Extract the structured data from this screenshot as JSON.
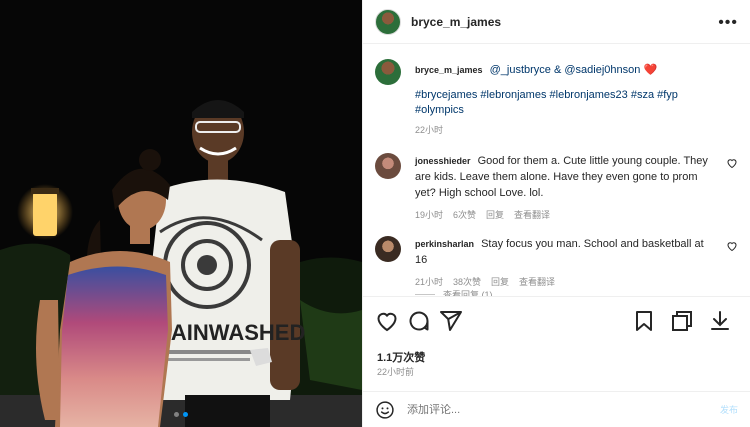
{
  "post": {
    "username": "bryce_m_james",
    "caption_user": "bryce_m_james",
    "caption_mentions": "@_justbryce & @sadiej0hnson",
    "caption_heart": "❤️",
    "hashtags": "#brycejames #lebronjames #lebronjames23 #sza #fyp #olympics",
    "caption_time": "22小时",
    "likes": "1.1万次赞",
    "posted_ago": "22小时前",
    "photo_shirt_text": "RAINWASHED",
    "carousel": {
      "count": 2,
      "active": 1
    }
  },
  "comments": [
    {
      "user": "jonesshieder",
      "text": "Good for them a. Cute little young couple. They are kids. Leave them alone. Have they even gone to prom yet? High school Love. lol.",
      "time": "19小时",
      "likes": "6次赞",
      "reply": "回复",
      "translate": "查看翻译"
    },
    {
      "user": "perkinsharlan",
      "text": "Stay focus you man. School and basketball at 16",
      "time": "21小时",
      "likes": "38次赞",
      "reply": "回复",
      "translate": "查看翻译",
      "view_replies": "查看回复 (1)"
    }
  ],
  "composer": {
    "placeholder": "添加评论...",
    "post_label": "发布"
  },
  "icons": [
    "more-icon",
    "heart-icon",
    "comment-icon",
    "share-icon",
    "bookmark-icon",
    "copy-icon",
    "download-icon",
    "emoji-icon"
  ]
}
